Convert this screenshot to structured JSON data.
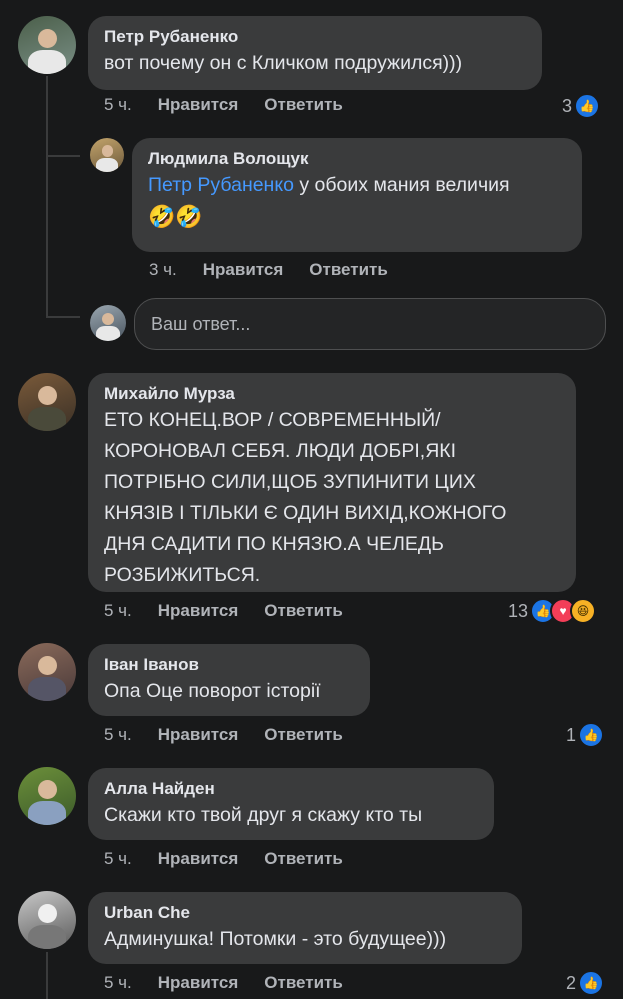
{
  "comments": [
    {
      "author": "Петр Рубаненко",
      "text": "вот почему он с Кличком подружился)))",
      "time": "5 ч.",
      "like_label": "Нравится",
      "reply_label": "Ответить",
      "reaction_count": "3",
      "reactions": [
        "like-icon"
      ]
    },
    {
      "author": "Людмила Волощук",
      "mention": "Петр Рубаненко",
      "text": " у обоих мания величия",
      "emoji": "🤣🤣",
      "time": "3 ч.",
      "like_label": "Нравится",
      "reply_label": "Ответить"
    },
    {
      "author": "Михайло Мурза",
      "text": "ЕТО КОНЕЦ.ВОР / СОВРЕМЕННЫЙ/\nКОРОНОВАЛ СЕБЯ. ЛЮДИ ДОБРІ,ЯКІ\nПОТРІБНО СИЛИ,ЩОБ ЗУПИНИТИ ЦИХ\nКНЯЗІВ І ТІЛЬКИ Є ОДИН ВИХІД,КОЖНОГО\nДНЯ САДИТИ ПО КНЯЗЮ.А ЧЕЛЕДЬ\nРОЗБИЖИТЬСЯ.",
      "time": "5 ч.",
      "like_label": "Нравится",
      "reply_label": "Ответить",
      "reaction_count": "13",
      "reactions": [
        "like-icon",
        "love-icon",
        "haha-icon"
      ]
    },
    {
      "author": "Іван Іванов",
      "text": "Опа Оце поворот історії",
      "time": "5 ч.",
      "like_label": "Нравится",
      "reply_label": "Ответить",
      "reaction_count": "1",
      "reactions": [
        "like-icon"
      ]
    },
    {
      "author": "Алла Найден",
      "text": "Скажи кто твой друг я скажу кто ты",
      "time": "5 ч.",
      "like_label": "Нравится",
      "reply_label": "Ответить"
    },
    {
      "author": "Urban Che",
      "text": "Админушка! Потомки - это будущее)))",
      "time": "5 ч.",
      "like_label": "Нравится",
      "reply_label": "Ответить",
      "reaction_count": "2",
      "reactions": [
        "like-icon"
      ]
    }
  ],
  "reply_input": {
    "placeholder": "Ваш ответ..."
  },
  "colors": {
    "background": "#18191a",
    "bubble": "#3a3b3c",
    "text": "#e4e6eb",
    "secondary": "#b0b3b8",
    "mention": "#4599ff",
    "like": "#1b74e4",
    "love": "#f33e58",
    "haha": "#f7b125"
  }
}
